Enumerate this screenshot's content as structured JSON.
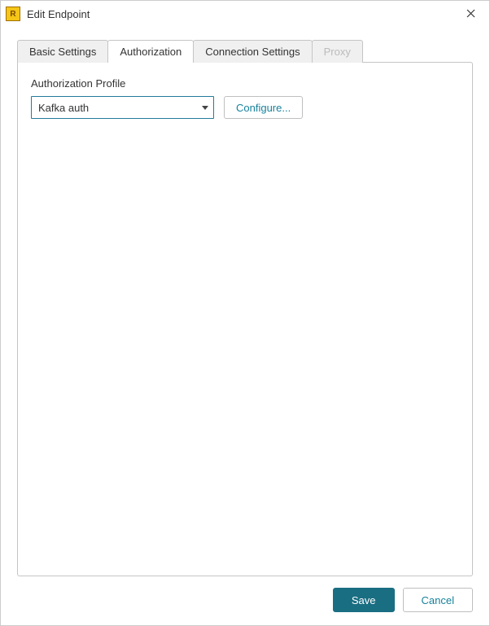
{
  "window": {
    "title": "Edit Endpoint"
  },
  "tabs": [
    {
      "label": "Basic Settings",
      "active": false,
      "disabled": false
    },
    {
      "label": "Authorization",
      "active": true,
      "disabled": false
    },
    {
      "label": "Connection Settings",
      "active": false,
      "disabled": false
    },
    {
      "label": "Proxy",
      "active": false,
      "disabled": true
    }
  ],
  "authorization": {
    "profile_label": "Authorization Profile",
    "selected_profile": "Kafka auth",
    "configure_label": "Configure..."
  },
  "footer": {
    "save_label": "Save",
    "cancel_label": "Cancel"
  },
  "colors": {
    "accent": "#17829c",
    "primary_bg": "#1a6e82",
    "border": "#c5c5c5"
  }
}
